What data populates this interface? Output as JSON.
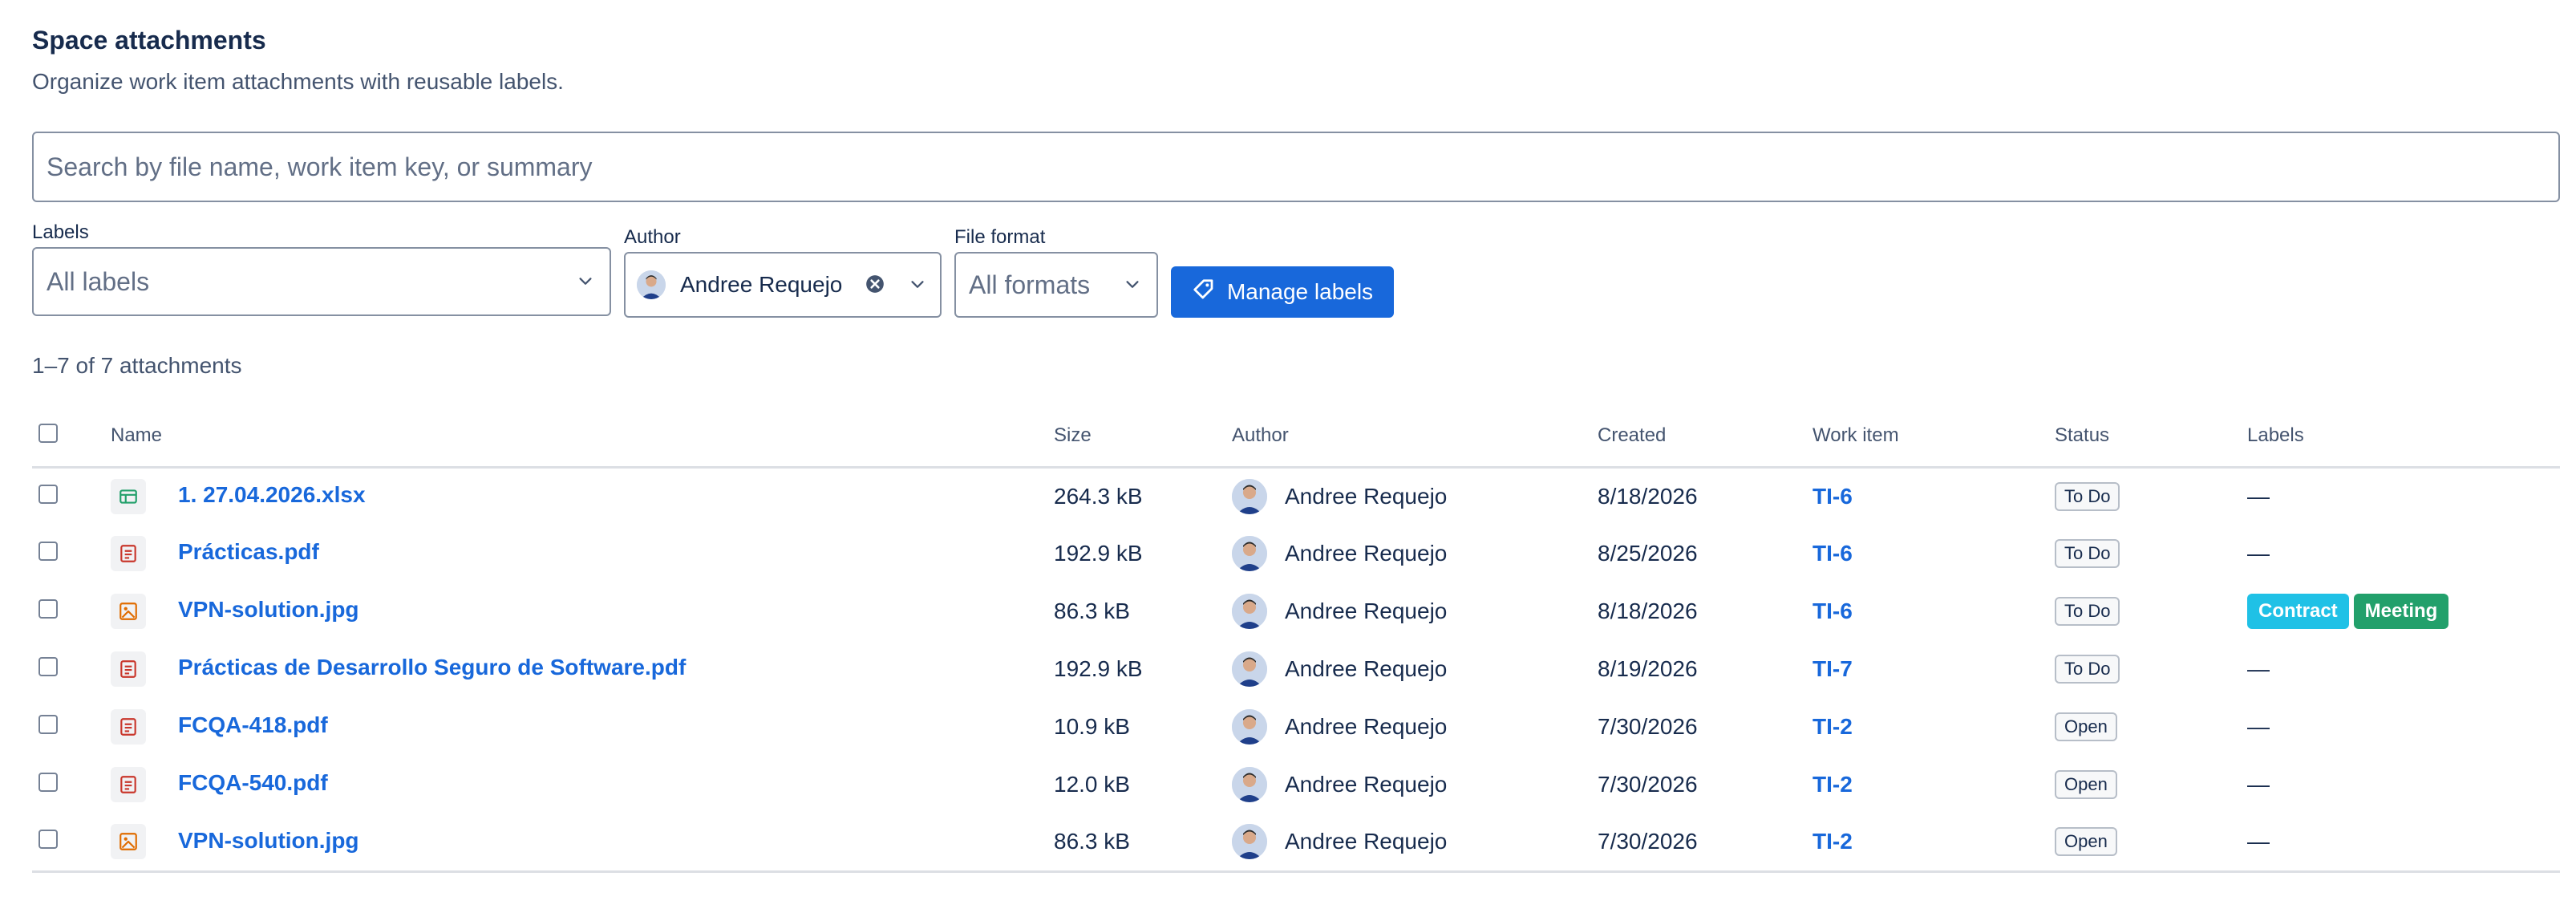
{
  "header": {
    "title": "Space attachments",
    "subtitle": "Organize work item attachments with reusable labels."
  },
  "search": {
    "placeholder": "Search by file name, work item key, or summary",
    "value": ""
  },
  "filters": {
    "labels": {
      "label": "Labels",
      "value": "All labels"
    },
    "author": {
      "label": "Author",
      "value": "Andree Requejo"
    },
    "format": {
      "label": "File format",
      "value": "All formats"
    },
    "manage_button": "Manage labels"
  },
  "count_text": "1–7 of 7 attachments",
  "table": {
    "columns": [
      "Name",
      "Size",
      "Author",
      "Created",
      "Work item",
      "Status",
      "Labels"
    ],
    "rows": [
      {
        "icon": "spreadsheet-icon",
        "name": "1. 27.04.2026.xlsx",
        "size": "264.3 kB",
        "author": "Andree Requejo",
        "created": "8/18/2026",
        "work_item": "TI-6",
        "status": "To Do",
        "labels": []
      },
      {
        "icon": "pdf-icon",
        "name": "Prácticas.pdf",
        "size": "192.9 kB",
        "author": "Andree Requejo",
        "created": "8/25/2026",
        "work_item": "TI-6",
        "status": "To Do",
        "labels": []
      },
      {
        "icon": "image-icon",
        "name": "VPN-solution.jpg",
        "size": "86.3 kB",
        "author": "Andree Requejo",
        "created": "8/18/2026",
        "work_item": "TI-6",
        "status": "To Do",
        "labels": [
          {
            "text": "Contract",
            "color": "#1fc1e6"
          },
          {
            "text": "Meeting",
            "color": "#22a06b"
          }
        ]
      },
      {
        "icon": "pdf-icon",
        "name": "Prácticas de Desarrollo Seguro de Software.pdf",
        "size": "192.9 kB",
        "author": "Andree Requejo",
        "created": "8/19/2026",
        "work_item": "TI-7",
        "status": "To Do",
        "labels": []
      },
      {
        "icon": "pdf-icon",
        "name": "FCQA-418.pdf",
        "size": "10.9 kB",
        "author": "Andree Requejo",
        "created": "7/30/2026",
        "work_item": "TI-2",
        "status": "Open",
        "labels": []
      },
      {
        "icon": "pdf-icon",
        "name": "FCQA-540.pdf",
        "size": "12.0 kB",
        "author": "Andree Requejo",
        "created": "7/30/2026",
        "work_item": "TI-2",
        "status": "Open",
        "labels": []
      },
      {
        "icon": "image-icon",
        "name": "VPN-solution.jpg",
        "size": "86.3 kB",
        "author": "Andree Requejo",
        "created": "7/30/2026",
        "work_item": "TI-2",
        "status": "Open",
        "labels": []
      }
    ],
    "empty_label": "—"
  },
  "colors": {
    "primary": "#1868db",
    "spreadsheet_icon": "#22a06b",
    "pdf_icon": "#c9372c",
    "image_icon": "#e06c00"
  }
}
